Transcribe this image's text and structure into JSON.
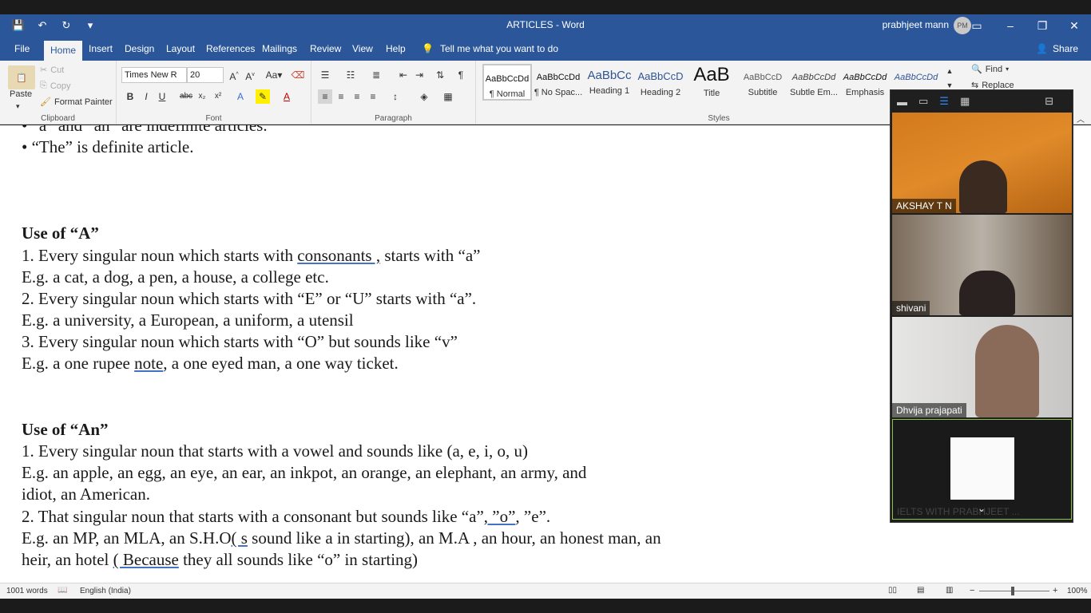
{
  "window": {
    "title": "ARTICLES - Word",
    "user_name": "prabhjeet mann",
    "user_initials": "PM"
  },
  "tabs": [
    "File",
    "Home",
    "Insert",
    "Design",
    "Layout",
    "References",
    "Mailings",
    "Review",
    "View",
    "Help"
  ],
  "tell_me": "Tell me what you want to do",
  "share": "Share",
  "clipboard": {
    "paste": "Paste",
    "cut": "Cut",
    "copy": "Copy",
    "format_painter": "Format Painter",
    "group": "Clipboard"
  },
  "font": {
    "name": "Times New R",
    "size": "20",
    "group": "Font"
  },
  "paragraph": {
    "group": "Paragraph"
  },
  "styles": {
    "group": "Styles",
    "items": [
      {
        "preview": "AaBbCcDd",
        "name": "¶ Normal"
      },
      {
        "preview": "AaBbCcDd",
        "name": "¶ No Spac..."
      },
      {
        "preview": "AaBbCc",
        "name": "Heading 1"
      },
      {
        "preview": "AaBbCcD",
        "name": "Heading 2"
      },
      {
        "preview": "AaB",
        "name": "Title"
      },
      {
        "preview": "AaBbCcD",
        "name": "Subtitle"
      },
      {
        "preview": "AaBbCcDd",
        "name": "Subtle Em..."
      },
      {
        "preview": "AaBbCcDd",
        "name": "Emphasis"
      },
      {
        "preview": "AaBbCcDd",
        "name": ""
      }
    ]
  },
  "editing": {
    "find": "Find",
    "replace": "Replace"
  },
  "document": {
    "l0": "• “a” and “an” are indefinite articles.",
    "l1": "• “The” is definite article.",
    "h1": "Use of “A”",
    "a1a": "1. Every singular noun which starts with ",
    "a1b": "consonants ,",
    "a1c": " starts with “a”",
    "a2": "E.g. a cat, a dog, a pen, a house, a college etc.",
    "a3": "2. Every singular noun which starts with “E” or “U” starts with “a”.",
    "a4": "E.g. a university, a European, a uniform, a utensil",
    "a5": "3. Every singular noun which starts with “O” but sounds like “v”",
    "a6a": "E.g. a one rupee ",
    "a6b": "note",
    "a6c": ", a one eyed man, a one way ticket.",
    "h2": "Use of “An”",
    "b1": "1. Every singular noun that starts with a vowel and sounds like (a, e, i, o, u)",
    "b2": "E.g. an apple, an egg, an eye, an ear, an inkpot, an orange, an elephant, an army, and",
    "b3": "idiot, an American.",
    "b4a": "2. That singular noun that starts with a consonant but sounds like “a”",
    "b4b": ", ”o”",
    "b4c": ", ”e”.",
    "b5a": "E.g. an MP, an MLA, an S.H.O",
    "b5b": "( s",
    "b5c": " sound like a in starting), an M.A , an hour, an honest man, an",
    "b6a": "heir, an hotel ",
    "b6b": "( Because",
    "b6c": " they all sounds like “o” in starting)"
  },
  "status": {
    "words": "1001 words",
    "language": "English (India)",
    "zoom": "100%"
  },
  "video": {
    "participants": [
      "AKSHAY T N",
      "shivani",
      "Dhvija prajapati",
      "IELTS WITH PRABHJEET ..."
    ]
  }
}
